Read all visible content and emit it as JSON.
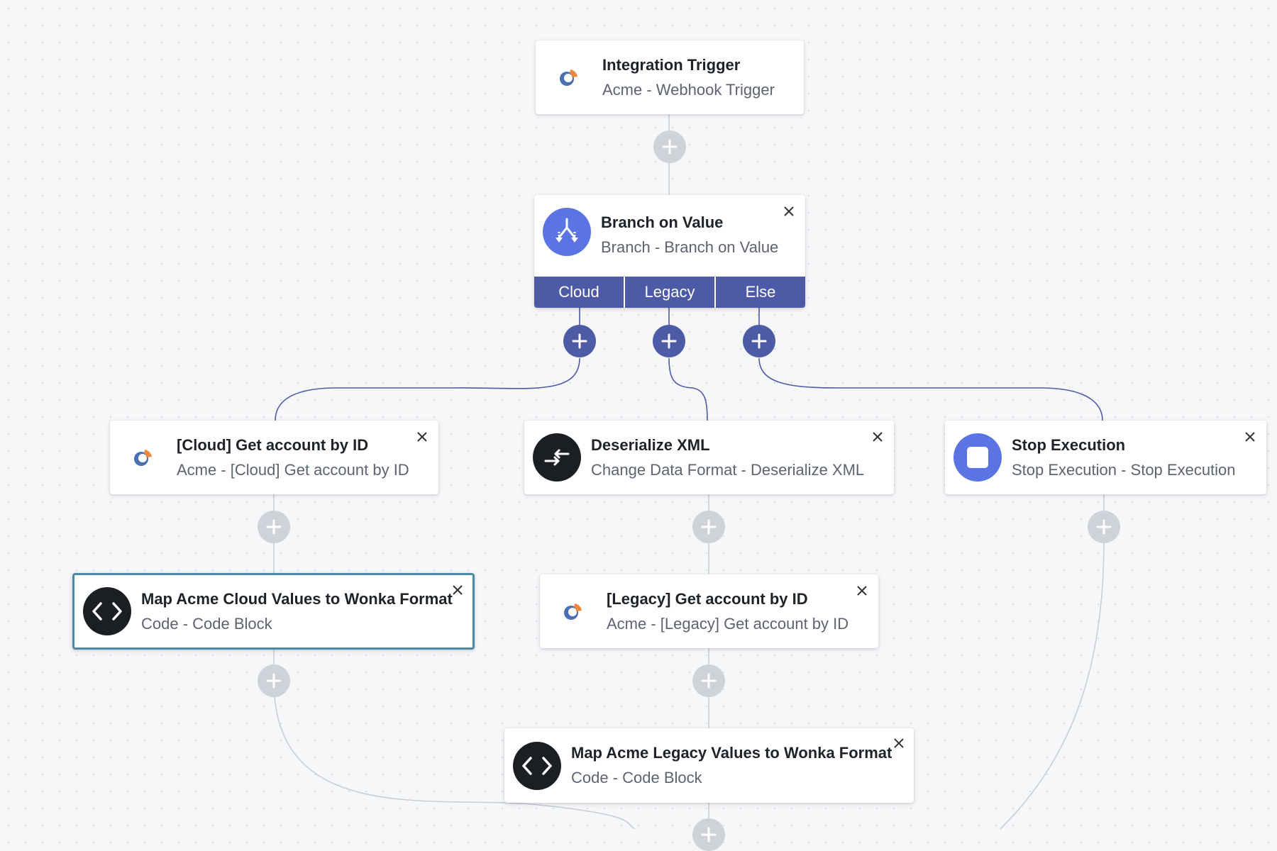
{
  "colors": {
    "canvas_bg": "#f6f7f9",
    "branch_bar": "#4d5aa6",
    "connector_gray": "#c9ced6",
    "connector_navy": "#4d5aa6",
    "stop_icon_bg": "#5b74e3",
    "code_icon_bg": "#1b1f24",
    "selected_border": "#4a8aa8"
  },
  "nodes": {
    "trigger": {
      "title": "Integration Trigger",
      "subtitle": "Acme - Webhook Trigger",
      "icon": "acme-logo-icon"
    },
    "branch": {
      "title": "Branch on Value",
      "subtitle": "Branch - Branch on Value",
      "icon": "branch-icon",
      "branches": [
        "Cloud",
        "Legacy",
        "Else"
      ]
    },
    "cloud_get": {
      "title": "[Cloud] Get account by ID",
      "subtitle": "Acme - [Cloud] Get account by ID",
      "icon": "acme-logo-icon"
    },
    "deserialize": {
      "title": "Deserialize XML",
      "subtitle": "Change Data Format - Deserialize XML",
      "icon": "swap-arrows-icon"
    },
    "stop": {
      "title": "Stop Execution",
      "subtitle": "Stop Execution - Stop Execution",
      "icon": "stop-icon"
    },
    "map_cloud": {
      "title": "Map Acme Cloud Values to Wonka Format",
      "subtitle": "Code - Code Block",
      "icon": "code-icon"
    },
    "legacy_get": {
      "title": "[Legacy] Get account by ID",
      "subtitle": "Acme - [Legacy] Get account by ID",
      "icon": "acme-logo-icon"
    },
    "map_legacy": {
      "title": "Map Acme Legacy Values to Wonka Format",
      "subtitle": "Code - Code Block",
      "icon": "code-icon"
    }
  }
}
